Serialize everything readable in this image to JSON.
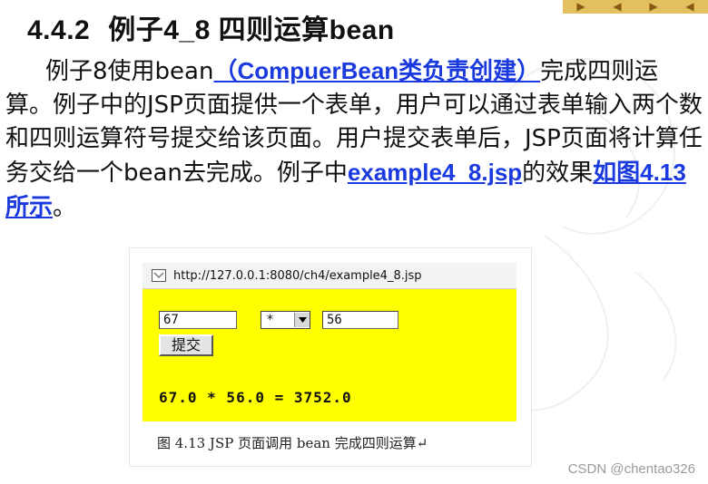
{
  "heading": {
    "number": "4.4.2",
    "title": "例子4_8 四则运算bean"
  },
  "paragraph": {
    "text1": "例子8使用bean",
    "link1": "（CompuerBean类负责创建）",
    "text2": "完成四则运算。例子中的JSP页面提供一个表单，用户可以通过表单输入两个数和四则运算符号提交给该页面。用户提交表单后，JSP页面将计算任务交给一个bean去完成。例子中",
    "link2": "example4_8.jsp",
    "text3": "的效果",
    "link3": "如图4.13所示",
    "text4": "。"
  },
  "figure": {
    "url": "http://127.0.0.1:8080/ch4/example4_8.jsp",
    "operand1": "67",
    "operator": "*",
    "operand2": "56",
    "submit_label": "提交",
    "result": "67.0 * 56.0 = 3752.0",
    "caption": "图 4.13  JSP 页面调用 bean 完成四则运算↵"
  },
  "credit": "CSDN @chentao326",
  "colors": {
    "link": "#1a3adf",
    "form_bg": "#ffff00",
    "nav_bar": "#e3c060"
  }
}
